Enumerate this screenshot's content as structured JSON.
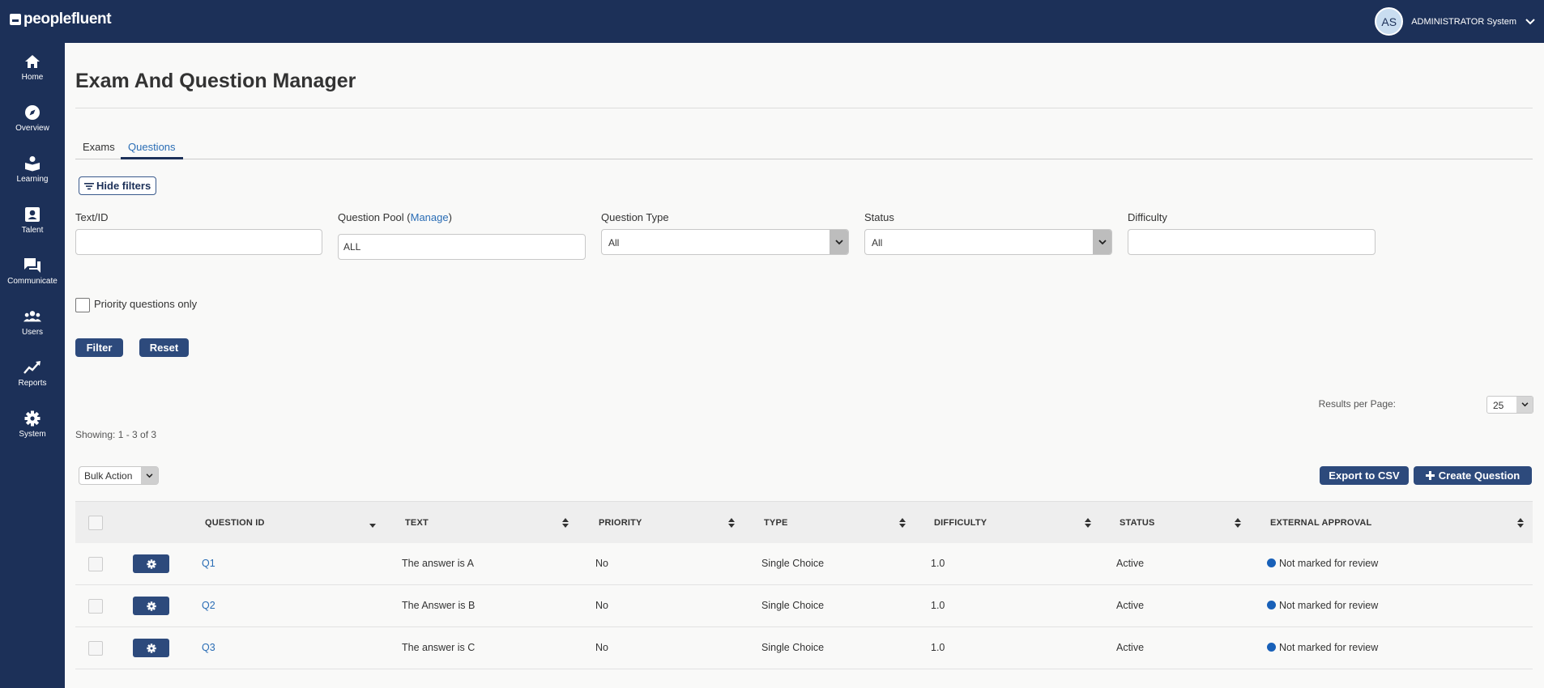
{
  "header": {
    "brand": "peoplefluent",
    "user_initials": "AS",
    "user_name": "ADMINISTRATOR System"
  },
  "sidebar": {
    "items": [
      {
        "label": "Home",
        "icon": "home-icon"
      },
      {
        "label": "Overview",
        "icon": "compass-icon"
      },
      {
        "label": "Learning",
        "icon": "learning-icon"
      },
      {
        "label": "Talent",
        "icon": "talent-icon"
      },
      {
        "label": "Communicate",
        "icon": "chat-icon"
      },
      {
        "label": "Users",
        "icon": "users-icon"
      },
      {
        "label": "Reports",
        "icon": "reports-icon"
      },
      {
        "label": "System",
        "icon": "gear-icon"
      }
    ]
  },
  "page": {
    "title": "Exam And Question Manager",
    "tabs": [
      {
        "label": "Exams",
        "active": false
      },
      {
        "label": "Questions",
        "active": true
      }
    ],
    "hide_filters_label": "Hide filters"
  },
  "filters": {
    "text_id_label": "Text/ID",
    "text_id_value": "",
    "pool_label": "Question Pool (",
    "pool_link": "Manage",
    "pool_label_close": ")",
    "pool_value": "ALL",
    "type_label": "Question Type",
    "type_value": "All",
    "status_label": "Status",
    "status_value": "All",
    "difficulty_label": "Difficulty",
    "difficulty_value": "",
    "priority_label": "Priority questions only",
    "priority_checked": false,
    "filter_button": "Filter",
    "reset_button": "Reset"
  },
  "results": {
    "per_page_label": "Results per Page:",
    "per_page_value": "25",
    "showing": "Showing: 1 - 3 of 3",
    "bulk_action": "Bulk Action",
    "export_button": "Export to CSV",
    "create_button": "Create Question"
  },
  "table": {
    "columns": [
      "QUESTION ID",
      "TEXT",
      "PRIORITY",
      "TYPE",
      "DIFFICULTY",
      "STATUS",
      "EXTERNAL APPROVAL"
    ],
    "rows": [
      {
        "id": "Q1",
        "text": "The answer is A",
        "priority": "No",
        "type": "Single Choice",
        "difficulty": "1.0",
        "status": "Active",
        "approval": "Not marked for review"
      },
      {
        "id": "Q2",
        "text": "The Answer is B",
        "priority": "No",
        "type": "Single Choice",
        "difficulty": "1.0",
        "status": "Active",
        "approval": "Not marked for review"
      },
      {
        "id": "Q3",
        "text": "The answer is C",
        "priority": "No",
        "type": "Single Choice",
        "difficulty": "1.0",
        "status": "Active",
        "approval": "Not marked for review"
      }
    ]
  },
  "colors": {
    "nav_bg": "#1c3058",
    "primary_button": "#2d4a7c",
    "link": "#2a6db5",
    "status_dot": "#1860b8"
  }
}
